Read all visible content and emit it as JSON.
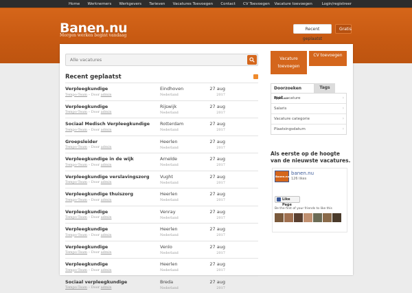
{
  "nav": {
    "left": [
      "Home",
      "Werknemers",
      "Werkgevers",
      "Tarieven",
      "Vacatures Toevoegen",
      "Contact",
      "CV Toevoegen"
    ],
    "right": [
      "Vacature toevoegen",
      "Login/registreer"
    ]
  },
  "header": {
    "logo": "Banen.nu",
    "tagline": "Morgen werken begint vandaag",
    "btn_recent": "Recent geplaatst",
    "btn_gratis": "Gratis"
  },
  "search": {
    "placeholder": "Alle vacatures"
  },
  "recent": {
    "title": "Recent geplaatst",
    "jobs": [
      {
        "title": "Verpleegkundige",
        "agency": "Tempo-Team",
        "by": "Door",
        "author": "admin",
        "city": "Eindhoven",
        "country": "Nederland",
        "date": "27 aug",
        "year": "2017"
      },
      {
        "title": "Verpleegkundige",
        "agency": "Tempo-Team",
        "by": "Door",
        "author": "admin",
        "city": "Rijswijk",
        "country": "Nederland",
        "date": "27 aug",
        "year": "2017"
      },
      {
        "title": "Sociaal Medisch Verpleegkundige",
        "agency": "Tempo-Team",
        "by": "Door",
        "author": "admin",
        "city": "Rotterdam",
        "country": "Nederland",
        "date": "27 aug",
        "year": "2017"
      },
      {
        "title": "Groepsleider",
        "agency": "Tempo-Team",
        "by": "Door",
        "author": "admin",
        "city": "Heerlen",
        "country": "Nederland",
        "date": "27 aug",
        "year": "2017"
      },
      {
        "title": "Verpleegkundige in de wijk",
        "agency": "Tempo-Team",
        "by": "Door",
        "author": "admin",
        "city": "Arnelde",
        "country": "Nederland",
        "date": "27 aug",
        "year": "2017"
      },
      {
        "title": "Verpleegkundige verslavingszorg",
        "agency": "Tempo-Team",
        "by": "Door",
        "author": "admin",
        "city": "Vught",
        "country": "Nederland",
        "date": "27 aug",
        "year": "2017"
      },
      {
        "title": "Verpleegkundige thuiszorg",
        "agency": "Tempo-Team",
        "by": "Door",
        "author": "admin",
        "city": "Heerlen",
        "country": "Nederland",
        "date": "27 aug",
        "year": "2017"
      },
      {
        "title": "Verpleegkundige",
        "agency": "Tempo-Team",
        "by": "Door",
        "author": "admin",
        "city": "Venray",
        "country": "Nederland",
        "date": "27 aug",
        "year": "2017"
      },
      {
        "title": "Verpleegkundige",
        "agency": "Tempo-Team",
        "by": "Door",
        "author": "admin",
        "city": "Heerlen",
        "country": "Nederland",
        "date": "27 aug",
        "year": "2017"
      },
      {
        "title": "Verpleegkundige",
        "agency": "Tempo-Team",
        "by": "Door",
        "author": "admin",
        "city": "Venlo",
        "country": "Nederland",
        "date": "27 aug",
        "year": "2017"
      },
      {
        "title": "Verpleegkundige",
        "agency": "Tempo-Team",
        "by": "Door",
        "author": "admin",
        "city": "Heerlen",
        "country": "Nederland",
        "date": "27 aug",
        "year": "2017"
      },
      {
        "title": "Sociaal verpleegkundige",
        "agency": "Tempo-Team",
        "by": "Door",
        "author": "admin",
        "city": "Breda",
        "country": "Nederland",
        "date": "27 aug",
        "year": "2017"
      }
    ]
  },
  "sidebar": {
    "btn_vacature_line1": "Vacature",
    "btn_vacature_line2": "toevoegen",
    "btn_cv": "CV toevoegen",
    "tab_active": "Doorzoeken met...",
    "tab_inactive": "Tags",
    "filters": [
      "Type vacature",
      "Salaris",
      "Vacature categorie",
      "Plaatsingsdatum"
    ],
    "promo_line1": "Als eerste op de hoogte",
    "promo_line2": "van de nieuwste vacatures."
  },
  "facebook": {
    "page_name": "banen.nu",
    "logo_text": "Banen.nu",
    "likes": "126 likes",
    "like_button": "Like Page",
    "friends_text": "Be the first of your friends to like this"
  },
  "colors": {
    "accent": "#d4661c",
    "topbar": "#2d2d2d",
    "facebook": "#3b5998"
  }
}
